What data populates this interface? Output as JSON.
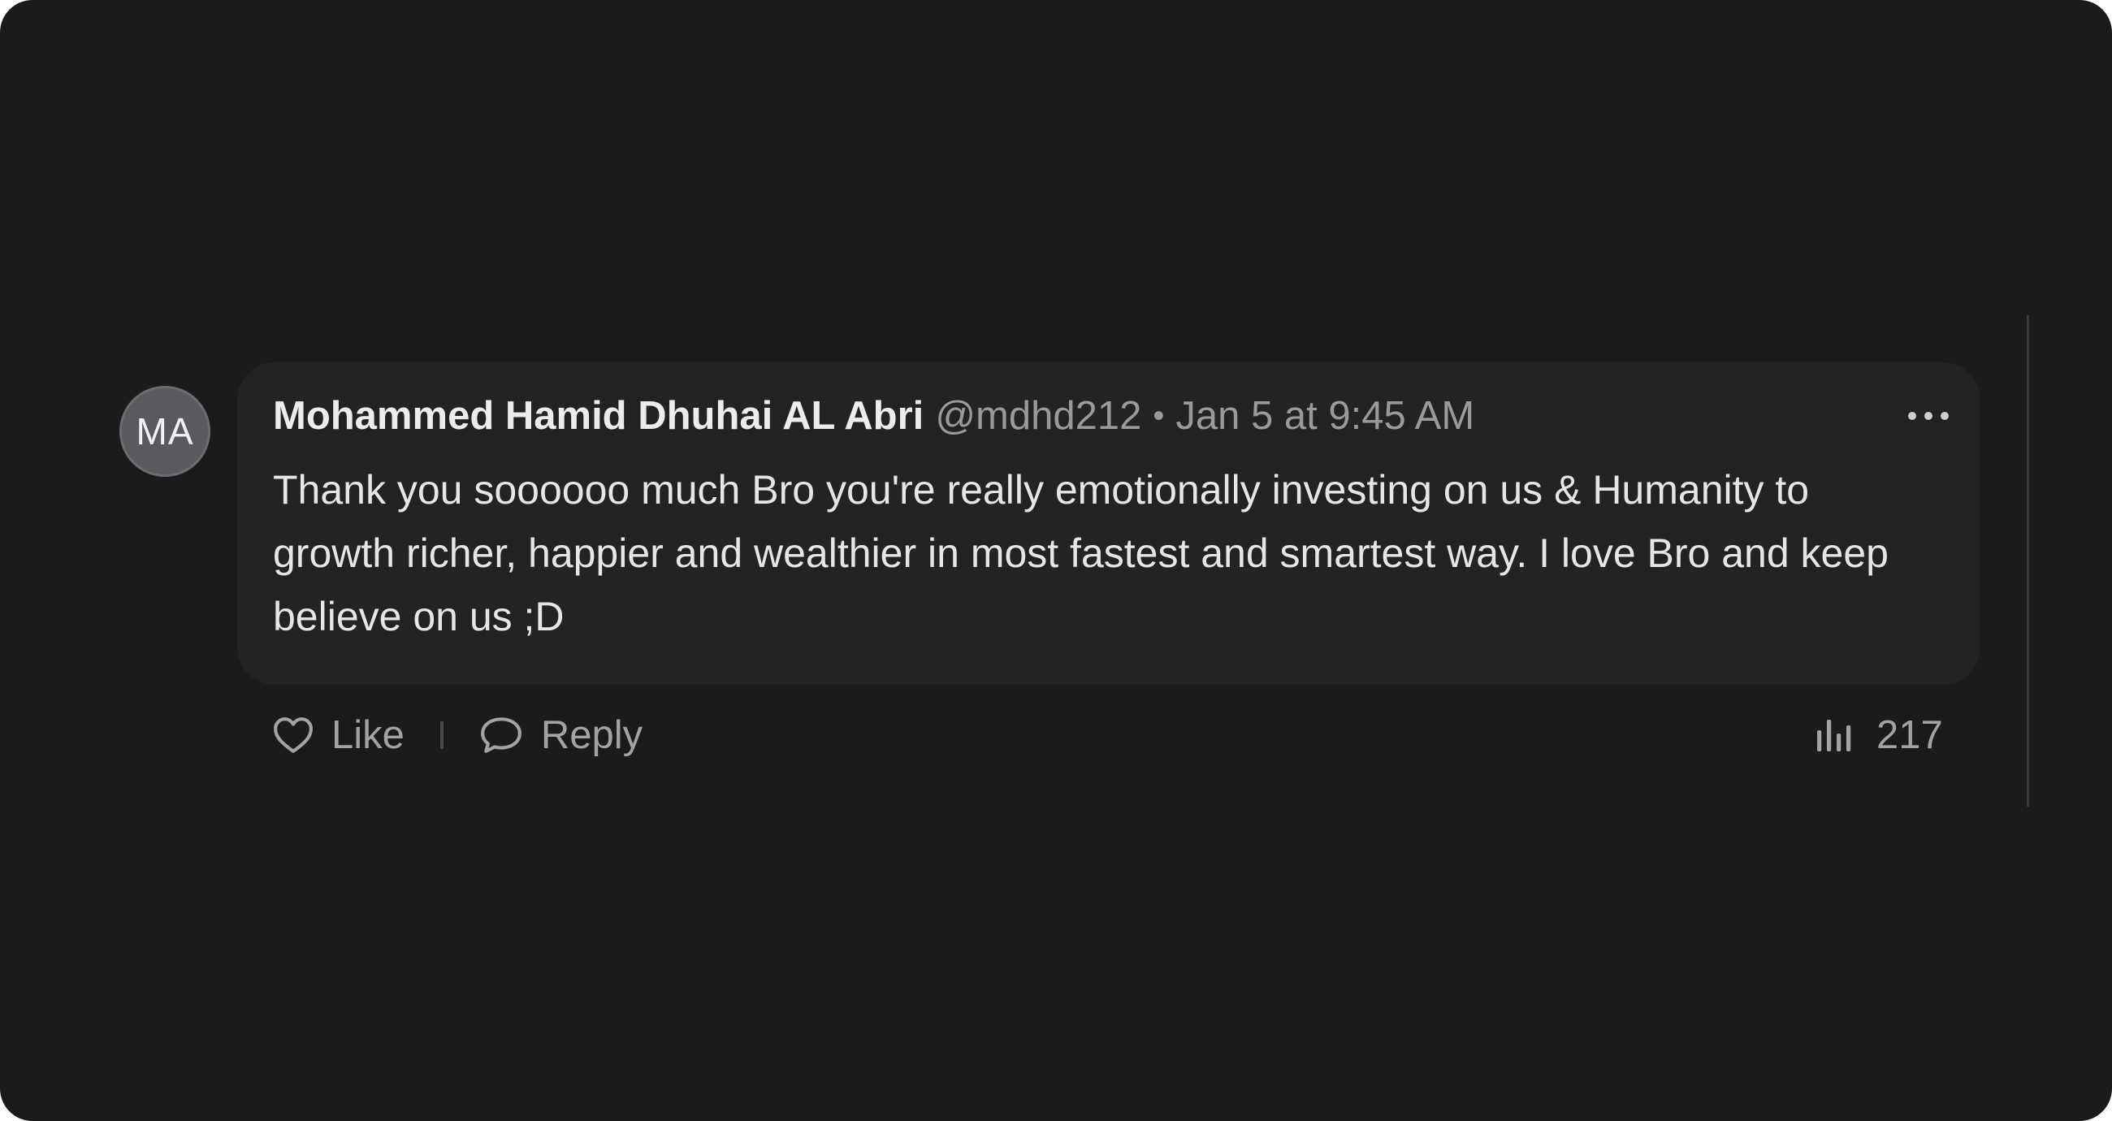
{
  "comment": {
    "avatar_initials": "MA",
    "author": "Mohammed Hamid Dhuhai AL Abri",
    "handle": "@mdhd212",
    "separator": "•",
    "timestamp": "Jan 5 at 9:45 AM",
    "body": "Thank you soooooo much Bro you're really emotionally investing on us & Humanity to growth richer, happier and wealthier in most fastest and smartest way. I love Bro and keep believe on us ;D",
    "more_icon": "more-horizontal-icon"
  },
  "actions": {
    "like_label": "Like",
    "like_icon": "heart-icon",
    "reply_label": "Reply",
    "reply_icon": "speech-bubble-icon",
    "views_icon": "bar-chart-icon",
    "views_count": "217"
  },
  "colors": {
    "background": "#1b1b1b",
    "bubble": "#232323",
    "text_primary": "#ececec",
    "text_secondary": "#9a9a9a",
    "avatar": "#5a5a5e"
  }
}
